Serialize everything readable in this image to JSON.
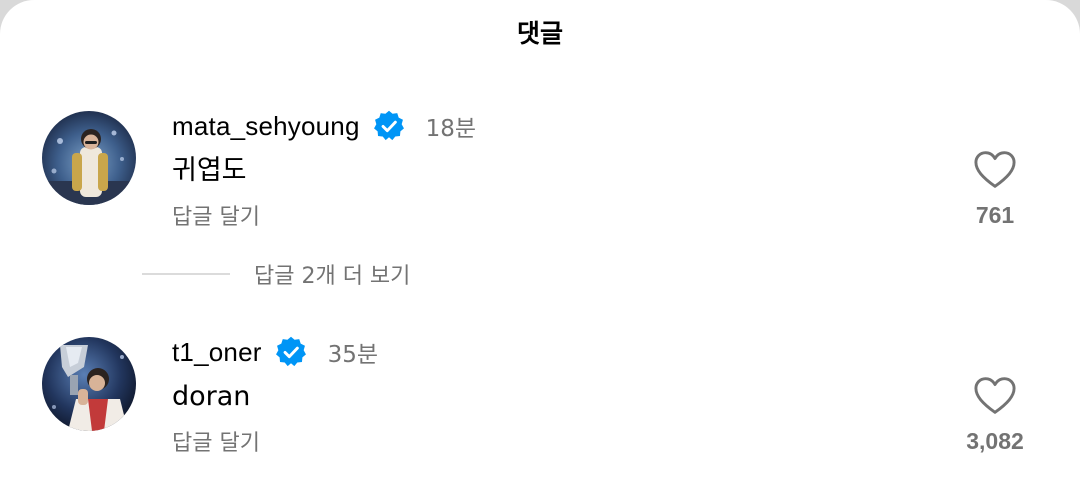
{
  "header": {
    "title": "댓글"
  },
  "comments": [
    {
      "username": "mata_sehyoung",
      "verified": true,
      "time": "18분",
      "text": "귀엽도",
      "reply_label": "답글 달기",
      "like_count": "761",
      "avatar": "trophy-ceremony-avatar"
    },
    {
      "username": "t1_oner",
      "verified": true,
      "time": "35분",
      "text": "doran",
      "reply_label": "답글 달기",
      "like_count": "3,082",
      "avatar": "trophy-kiss-avatar"
    }
  ],
  "more_replies": {
    "label": "답글 2개 더 보기"
  },
  "colors": {
    "background": "#ffffff",
    "text_primary": "#000000",
    "text_secondary": "#737373",
    "verified_badge": "#0095f6",
    "divider": "#dbdbdb"
  },
  "icons": {
    "verified": "verified-badge-icon",
    "like": "heart-outline-icon"
  }
}
